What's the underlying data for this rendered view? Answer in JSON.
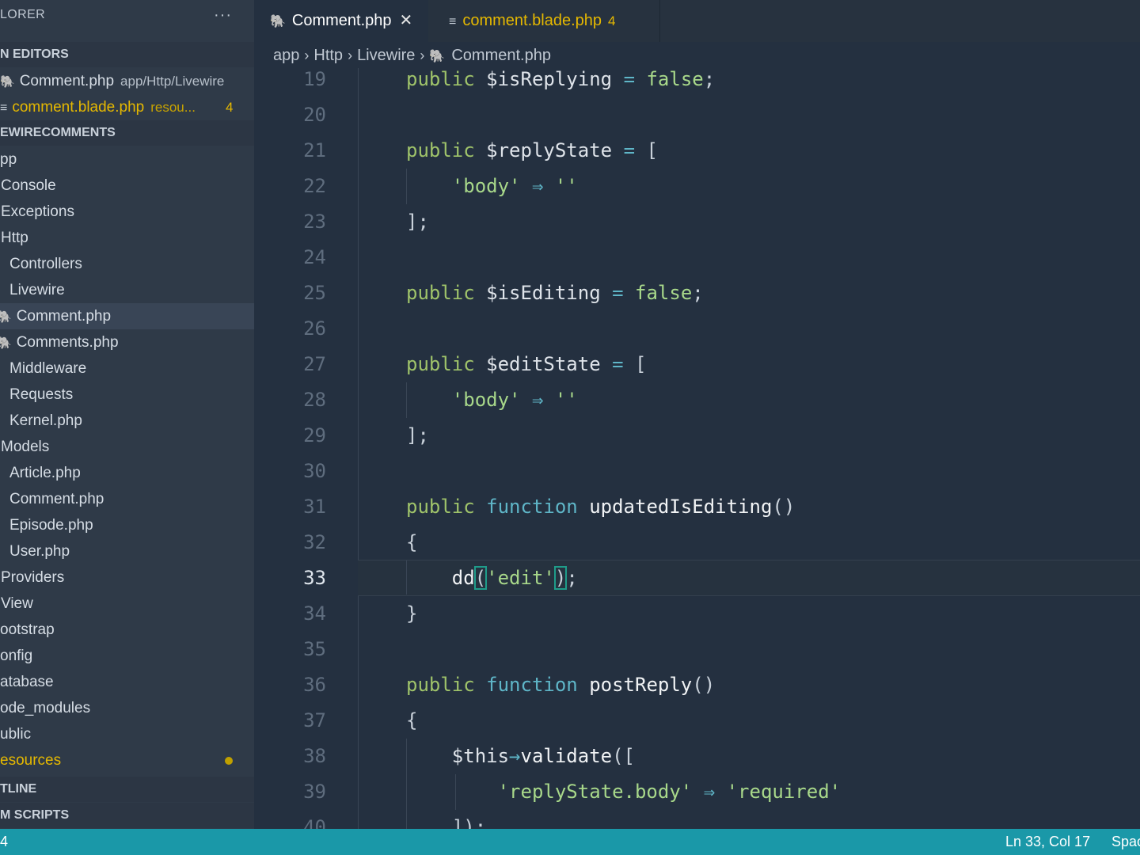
{
  "sidebar": {
    "title": "LORER",
    "more": "···",
    "open_editors_header": "N EDITORS",
    "open_editors": [
      {
        "label": "Comment.php",
        "desc": "app/Http/Livewire",
        "icon": "elephant-icon"
      },
      {
        "label": "comment.blade.php",
        "desc": "resou...",
        "badge": "4",
        "icon": "lines-icon"
      }
    ],
    "project_header": "EWIRECOMMENTS",
    "tree": [
      {
        "label": "pp"
      },
      {
        "label": "Console"
      },
      {
        "label": "Exceptions"
      },
      {
        "label": "Http"
      },
      {
        "label": "Controllers"
      },
      {
        "label": "Livewire"
      },
      {
        "label": "Comment.php"
      },
      {
        "label": "Comments.php"
      },
      {
        "label": "Middleware"
      },
      {
        "label": "Requests"
      },
      {
        "label": "Kernel.php"
      },
      {
        "label": "Models"
      },
      {
        "label": "Article.php"
      },
      {
        "label": "Comment.php"
      },
      {
        "label": "Episode.php"
      },
      {
        "label": "User.php"
      },
      {
        "label": "Providers"
      },
      {
        "label": "View"
      },
      {
        "label": "ootstrap"
      },
      {
        "label": "onfig"
      },
      {
        "label": "atabase"
      },
      {
        "label": "ode_modules"
      },
      {
        "label": "ublic"
      },
      {
        "label": "esources"
      }
    ],
    "outline_header": "TLINE",
    "scripts_header": "M SCRIPTS"
  },
  "tabs": [
    {
      "label": "Comment.php",
      "close": "✕"
    },
    {
      "label": "comment.blade.php",
      "badge": "4"
    }
  ],
  "breadcrumb": [
    "app",
    "Http",
    "Livewire",
    "Comment.php"
  ],
  "editor": {
    "lines": [
      "19",
      "20",
      "21",
      "22",
      "23",
      "24",
      "25",
      "26",
      "27",
      "28",
      "29",
      "30",
      "31",
      "32",
      "33",
      "34",
      "35",
      "36",
      "37",
      "38",
      "39",
      "40"
    ],
    "code": {
      "l19": [
        "public",
        "$isReplying",
        "=",
        "false",
        ";"
      ],
      "l21": [
        "public",
        "$replyState",
        "=",
        "["
      ],
      "l22": [
        "'body'",
        "⇒",
        "''"
      ],
      "l23": [
        "];"
      ],
      "l25": [
        "public",
        "$isEditing",
        "=",
        "false",
        ";"
      ],
      "l27": [
        "public",
        "$editState",
        "=",
        "["
      ],
      "l28": [
        "'body'",
        "⇒",
        "''"
      ],
      "l29": [
        "];"
      ],
      "l31": [
        "public",
        "function",
        "updatedIsEditing",
        "()"
      ],
      "l32": [
        "{"
      ],
      "l33": [
        "dd",
        "(",
        "'edit'",
        ")",
        ";"
      ],
      "l34": [
        "}"
      ],
      "l36": [
        "public",
        "function",
        "postReply",
        "()"
      ],
      "l37": [
        "{"
      ],
      "l38": [
        "$this",
        "→",
        "validate",
        "(["
      ],
      "l39": [
        "'replyState.body'",
        "⇒",
        "'required'"
      ],
      "l40": [
        "]);"
      ]
    }
  },
  "statusbar": {
    "left": "4",
    "position": "Ln 33, Col 17",
    "spaces": "Spac"
  },
  "colors": {
    "statusbar": "#1a98a8",
    "modified": "#e5b800",
    "keyword": "#9fc36a",
    "function_kw": "#5fb6c8"
  }
}
